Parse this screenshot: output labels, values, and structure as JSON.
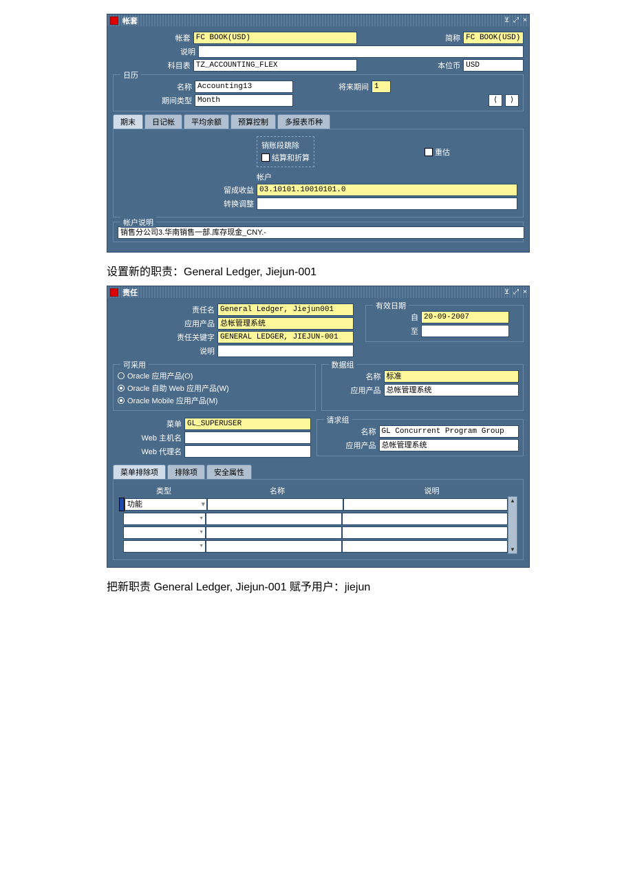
{
  "win1": {
    "title": "帐套",
    "labels": {
      "ledger": "帐套",
      "shortname": "简称",
      "desc": "说明",
      "coa": "科目表",
      "funcur": "本位币",
      "calendar": "日历",
      "calname": "名称",
      "future": "将来期间",
      "pertype": "期间类型",
      "tabs": [
        "期末",
        "日记帐",
        "平均余额",
        "预算控制",
        "多报表币种"
      ],
      "omitseg": "销账段跳除",
      "conrev": "结算和折算",
      "reval": "重估",
      "accounts": "帐户",
      "retearn": "留成收益",
      "transadj": "转换调整",
      "acctdesc": "帐户说明"
    },
    "values": {
      "ledger": "FC BOOK(USD)",
      "shortname": "FC BOOK(USD)",
      "desc": "",
      "coa": "TZ_ACCOUNTING_FLEX",
      "funcur": "USD",
      "calname": "Accounting13",
      "future": "1",
      "pertype": "Month",
      "retearn": "03.10101.10010101.0",
      "transadj": "",
      "acctdesc": "销售分公司3.华南销售一部.库存现金_CNY.-"
    }
  },
  "caption1": "设置新的职责：General Ledger, Jiejun-001",
  "win2": {
    "title": "责任",
    "labels": {
      "respname": "责任名",
      "app": "应用产品",
      "respkey": "责任关键字",
      "desc": "说明",
      "effdate": "有效日期",
      "from": "自",
      "to": "至",
      "avail": "可采用",
      "r1": "Oracle 应用产品(O)",
      "r2": "Oracle 自助 Web 应用产品(W)",
      "r3": "Oracle Mobile 应用产品(M)",
      "datagroup": "数据组",
      "dg_name": "名称",
      "dg_app": "应用产品",
      "menu": "菜单",
      "webhost": "Web 主机名",
      "webagent": "Web 代理名",
      "reqgroup": "请求组",
      "rg_name": "名称",
      "rg_app": "应用产品",
      "tabs": [
        "菜单排除项",
        "排除项",
        "安全属性"
      ],
      "cols": {
        "type": "类型",
        "name": "名称",
        "desc": "说明"
      },
      "rowtype": "功能"
    },
    "values": {
      "respname": "General Ledger, Jiejun001",
      "app": "总帐管理系统",
      "respkey": "GENERAL LEDGER, JIEJUN-001",
      "desc": "",
      "from": "20-09-2007",
      "to": "",
      "dg_name": "标准",
      "dg_app": "总帐管理系统",
      "menu": "GL_SUPERUSER",
      "webhost": "",
      "webagent": "",
      "rg_name": "GL Concurrent Program Group",
      "rg_app": "总帐管理系统"
    }
  },
  "caption2": "把新职责 General Ledger, Jiejun-001 赋予用户：jiejun"
}
